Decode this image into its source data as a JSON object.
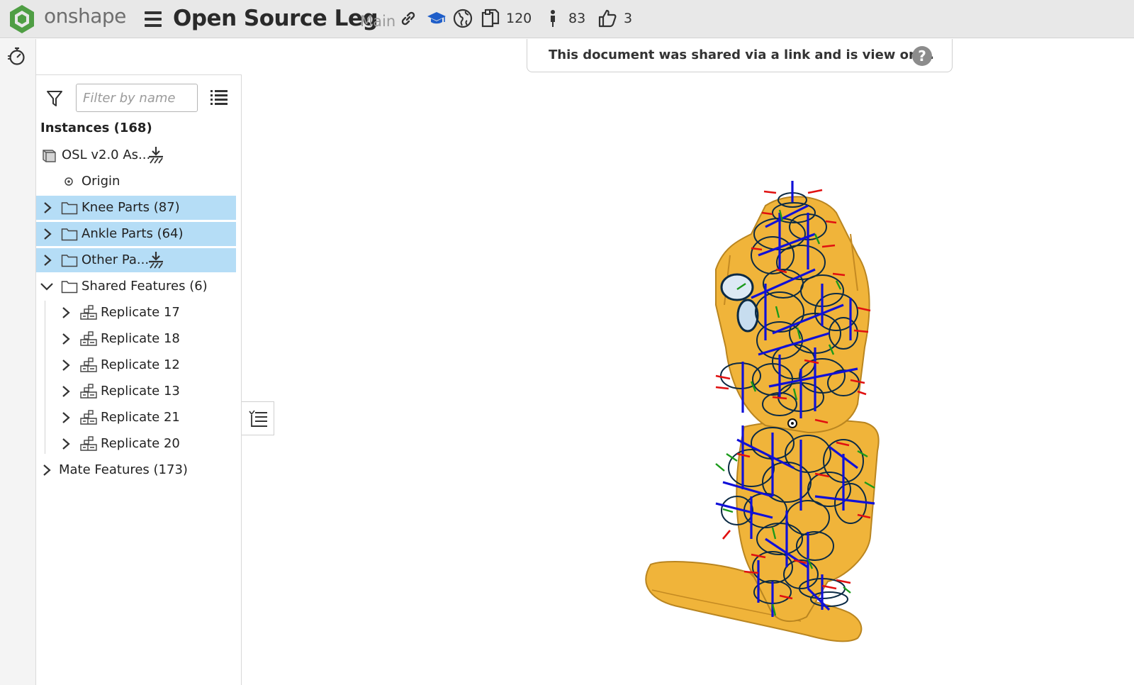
{
  "app": {
    "logo_text": "onshape",
    "document_title": "Open Source Leg",
    "branch": "Main",
    "copies_count": "120",
    "followers_count": "83",
    "likes_count": "3"
  },
  "banner": {
    "message": "This document was shared via a link and is view only.",
    "help_glyph": "?"
  },
  "panel": {
    "filter_placeholder": "Filter by name",
    "instances_heading": "Instances (168)",
    "tree": [
      {
        "label": "OSL v2.0 As...",
        "icon": "assembly-icon"
      },
      {
        "label": "Origin",
        "icon": "origin-icon"
      },
      {
        "label": "Knee Parts (87)",
        "icon": "folder-icon",
        "selected": true
      },
      {
        "label": "Ankle Parts (64)",
        "icon": "folder-icon",
        "selected": true
      },
      {
        "label": "Other Pa...",
        "icon": "folder-icon",
        "selected": true
      },
      {
        "label": "Shared Features (6)",
        "icon": "folder-icon"
      },
      {
        "label": "Replicate 17",
        "icon": "replicate-icon"
      },
      {
        "label": "Replicate 18",
        "icon": "replicate-icon"
      },
      {
        "label": "Replicate 12",
        "icon": "replicate-icon"
      },
      {
        "label": "Replicate 13",
        "icon": "replicate-icon"
      },
      {
        "label": "Replicate 21",
        "icon": "replicate-icon"
      },
      {
        "label": "Replicate 20",
        "icon": "replicate-icon"
      },
      {
        "label": "Mate Features (173)",
        "icon": "none"
      }
    ]
  },
  "colors": {
    "selection": "#b5ddf6",
    "model_body": "#f0b43a",
    "triad_red": "#e01010",
    "triad_green": "#1a9a1a",
    "triad_blue": "#1010d8",
    "mate_connector": "#0b2a44"
  }
}
